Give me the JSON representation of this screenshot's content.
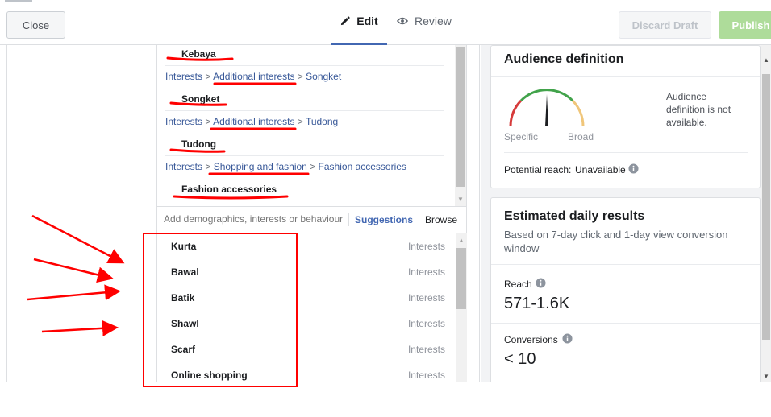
{
  "tabs": [
    {
      "label": "Edit",
      "icon": "pencil-icon",
      "active": true
    },
    {
      "label": "Review",
      "icon": "eye-icon",
      "active": false
    }
  ],
  "selected_interests": [
    {
      "name": "Kebaya"
    },
    {
      "path": [
        "Interests",
        "Additional interests",
        "Songket"
      ],
      "name": "Songket"
    },
    {
      "path": [
        "Interests",
        "Additional interests",
        "Tudong"
      ],
      "name": "Tudong"
    },
    {
      "path": [
        "Interests",
        "Shopping and fashion",
        "Fashion accessories"
      ],
      "name": "Fashion accessories"
    }
  ],
  "crumb_separator": ">",
  "search": {
    "placeholder": "Add demographics, interests or behaviours",
    "suggestions_label": "Suggestions",
    "browse_label": "Browse"
  },
  "results": [
    {
      "name": "Kurta",
      "type": "Interests"
    },
    {
      "name": "Bawal",
      "type": "Interests"
    },
    {
      "name": "Batik",
      "type": "Interests"
    },
    {
      "name": "Shawl",
      "type": "Interests"
    },
    {
      "name": "Scarf",
      "type": "Interests"
    },
    {
      "name": "Online shopping",
      "type": "Interests"
    }
  ],
  "audience": {
    "title": "Audience definition",
    "gauge_left": "Specific",
    "gauge_right": "Broad",
    "message": "Audience definition is not available.",
    "potential_reach_label": "Potential reach:",
    "potential_reach_value": "Unavailable"
  },
  "estimate": {
    "title": "Estimated daily results",
    "subtitle": "Based on 7-day click and 1-day view conversion window",
    "reach_label": "Reach",
    "reach_value": "571-1.6K",
    "conversions_label": "Conversions",
    "conversions_value": "< 10"
  },
  "footer": {
    "close_label": "Close",
    "discard_label": "Discard Draft",
    "publish_label": "Publish"
  },
  "colors": {
    "accent": "#4267b2",
    "link": "#385898",
    "annotation": "#ff0000",
    "publish": "#aedc9a"
  }
}
